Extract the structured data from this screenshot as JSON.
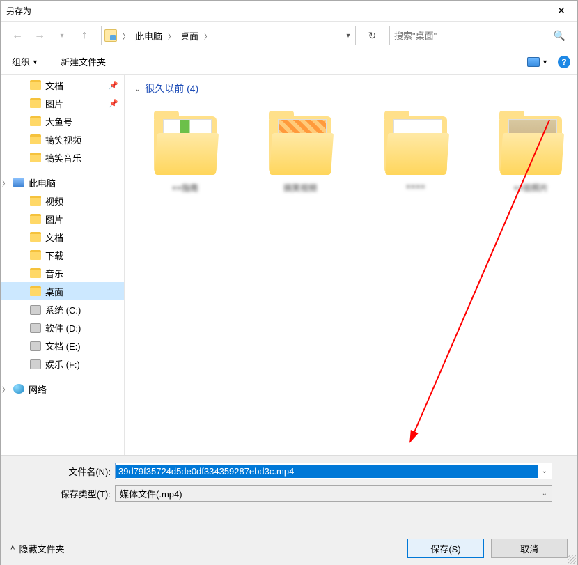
{
  "window": {
    "title": "另存为"
  },
  "nav": {
    "crumb1": "此电脑",
    "crumb2": "桌面"
  },
  "search": {
    "placeholder": "搜索\"桌面\""
  },
  "toolbar": {
    "organize": "组织",
    "newfolder": "新建文件夹"
  },
  "sidebar": {
    "items": [
      {
        "label": "文档",
        "icon": "folder",
        "pin": true,
        "level": 2
      },
      {
        "label": "图片",
        "icon": "folder",
        "pin": true,
        "level": 2
      },
      {
        "label": "大鱼号",
        "icon": "folder",
        "level": 2
      },
      {
        "label": "搞笑视频",
        "icon": "folder",
        "level": 2
      },
      {
        "label": "搞笑音乐",
        "icon": "folder",
        "level": 2
      },
      {
        "label": "此电脑",
        "icon": "pc",
        "level": 0,
        "expand": true
      },
      {
        "label": "视频",
        "icon": "folder",
        "level": 2
      },
      {
        "label": "图片",
        "icon": "folder",
        "level": 2
      },
      {
        "label": "文档",
        "icon": "folder",
        "level": 2
      },
      {
        "label": "下载",
        "icon": "folder",
        "level": 2
      },
      {
        "label": "音乐",
        "icon": "folder",
        "level": 2
      },
      {
        "label": "桌面",
        "icon": "folder",
        "level": 2,
        "selected": true
      },
      {
        "label": "系统 (C:)",
        "icon": "drive",
        "level": 2
      },
      {
        "label": "软件 (D:)",
        "icon": "drive",
        "level": 2
      },
      {
        "label": "文档 (E:)",
        "icon": "drive",
        "level": 2
      },
      {
        "label": "娱乐 (F:)",
        "icon": "drive",
        "level": 2
      },
      {
        "label": "网络",
        "icon": "net",
        "level": 0,
        "expand": true
      }
    ]
  },
  "content": {
    "group_label": "很久以前 (4)",
    "files": [
      {
        "name": "××指南",
        "thumb": "green"
      },
      {
        "label_index": 1,
        "name": "搞笑视频",
        "thumb": "zip"
      },
      {
        "label_index": 2,
        "name": "××××",
        "thumb": "pdf"
      },
      {
        "label_index": 3,
        "name": "××验照片",
        "thumb": "img"
      }
    ]
  },
  "form": {
    "filename_label": "文件名(N):",
    "filename_value": "39d79f35724d5de0df334359287ebd3c.mp4",
    "filetype_label": "保存类型(T):",
    "filetype_value": "媒体文件(.mp4)"
  },
  "footer": {
    "hide_folders": "隐藏文件夹",
    "save": "保存(S)",
    "cancel": "取消"
  }
}
